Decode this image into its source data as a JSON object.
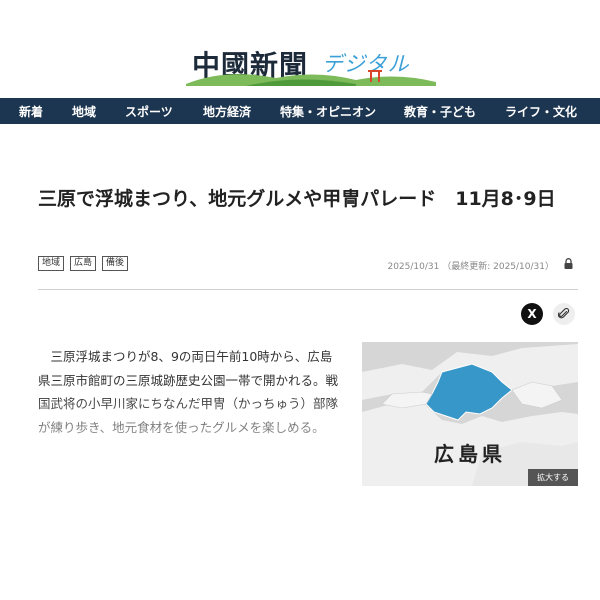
{
  "logo": {
    "main": "中國新聞",
    "sub": "デジタル"
  },
  "nav": [
    "新着",
    "地域",
    "スポーツ",
    "地方経済",
    "特集・オピニオン",
    "教育・子ども",
    "ライフ・文化"
  ],
  "article": {
    "headline": "三原で浮城まつり、地元グルメや甲冑パレード　11月8･9日",
    "tags": [
      "地域",
      "広島",
      "備後"
    ],
    "date": "2025/10/31",
    "updated": "（最終更新: 2025/10/31）",
    "body": "三原浮城まつりが8、9の両日午前10時から、広島県三原市館町の三原城跡歴史公園一帯で開かれる。戦国武将の小早川家にちなんだ甲冑（かっちゅう）部隊が練り歩き、地元食材を使ったグルメを楽しめる。"
  },
  "share": {
    "x_label": "X"
  },
  "map": {
    "label": "広島県",
    "enlarge": "拡大する"
  },
  "colors": {
    "nav_bg": "#1c3550",
    "map_highlight": "#3797c8",
    "accent": "#3ba0d8"
  }
}
